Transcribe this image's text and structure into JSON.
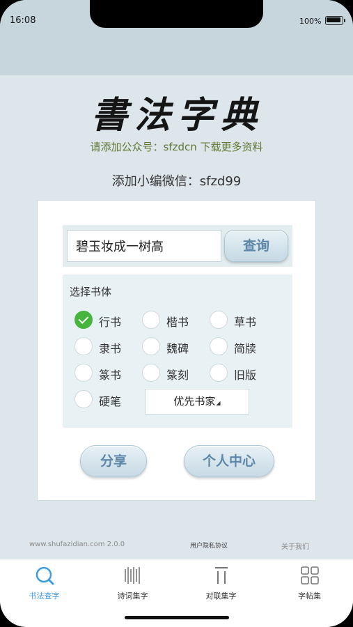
{
  "status": {
    "time": "16:08",
    "battery": "100%"
  },
  "logo_text": "書法字典",
  "promo": "请添加公众号：sfzdcn 下载更多资料",
  "wechat": "添加小编微信：sfzd99",
  "search": {
    "value": "碧玉妆成一树高",
    "button": "查询"
  },
  "fonts": {
    "title": "选择书体",
    "options": [
      {
        "label": "行书",
        "checked": true
      },
      {
        "label": "楷书",
        "checked": false
      },
      {
        "label": "草书",
        "checked": false
      },
      {
        "label": "隶书",
        "checked": false
      },
      {
        "label": "魏碑",
        "checked": false
      },
      {
        "label": "简牍",
        "checked": false
      },
      {
        "label": "篆书",
        "checked": false
      },
      {
        "label": "篆刻",
        "checked": false
      },
      {
        "label": "旧版",
        "checked": false
      },
      {
        "label": "硬笔",
        "checked": false
      }
    ],
    "calligrapher_select": "优先书家"
  },
  "buttons": {
    "share": "分享",
    "profile": "个人中心"
  },
  "footer": {
    "site": "www.shufazidian.com 2.0.0",
    "privacy": "用户隐私协议",
    "about": "关于我们"
  },
  "tabs": [
    {
      "label": "书法查字",
      "icon": "search-icon",
      "active": true
    },
    {
      "label": "诗词集字",
      "icon": "poem-lines-icon",
      "active": false
    },
    {
      "label": "对联集字",
      "icon": "couplet-icon",
      "active": false
    },
    {
      "label": "字帖集",
      "icon": "grid-icon",
      "active": false
    }
  ],
  "colors": {
    "accent": "#3d9be0",
    "checked": "#46b43d",
    "button_text": "#5c87a8",
    "promo": "#5f7833"
  }
}
